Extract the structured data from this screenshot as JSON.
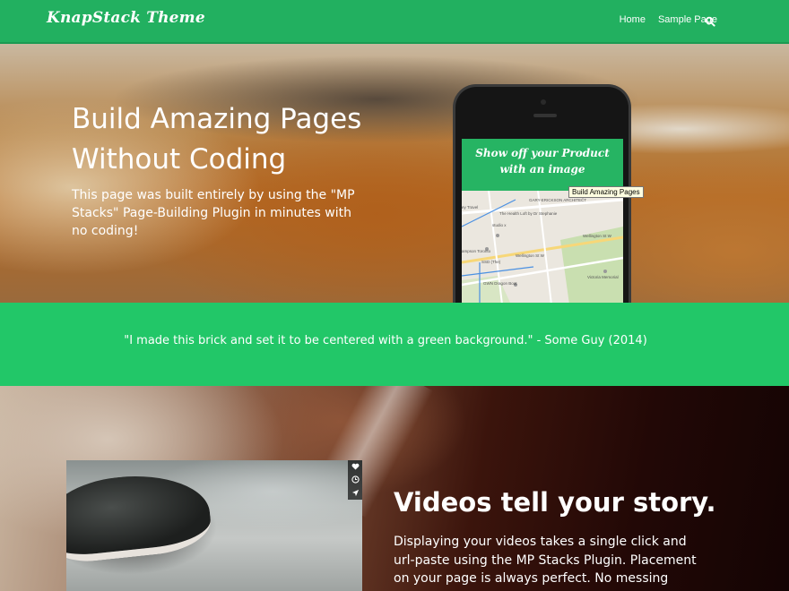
{
  "header": {
    "site_title": "KnapStack Theme",
    "nav": [
      {
        "label": "Home"
      },
      {
        "label": "Sample Page"
      }
    ],
    "search_icon": "search-icon",
    "bg_color": "#22b060"
  },
  "hero": {
    "title": "Build Amazing Pages Without Coding",
    "text": "This page was built entirely by using the \"MP Stacks\" Page-Building Plugin in minutes with no coding!",
    "phone": {
      "banner_text": "Show off your Product with an image",
      "banner_color": "#26b463",
      "map_labels": [
        "GARY-ERICKSON ARCHITECT",
        "Compose Troublemakers",
        "The Health Loft by Dr Stephanie",
        "studio x",
        "Wellington St W",
        "Wellington St W",
        "SSD (The)",
        "GWN Dragon Boat",
        "Victoria Memorial",
        "ampson Toronto",
        "ey Travel"
      ]
    },
    "tooltip": "Build Amazing Pages"
  },
  "quote": {
    "text": "\"I made this brick and set it to be centered with a green background.\" - Some Guy (2014)",
    "bg_color": "#22c768"
  },
  "video_section": {
    "heading": "Videos tell your story.",
    "text": "Displaying your videos takes a single click and url-paste using the MP Stacks Plugin. Placement on your page is always perfect. No messing with",
    "controls": [
      "heart-icon",
      "clock-icon",
      "send-icon"
    ]
  }
}
